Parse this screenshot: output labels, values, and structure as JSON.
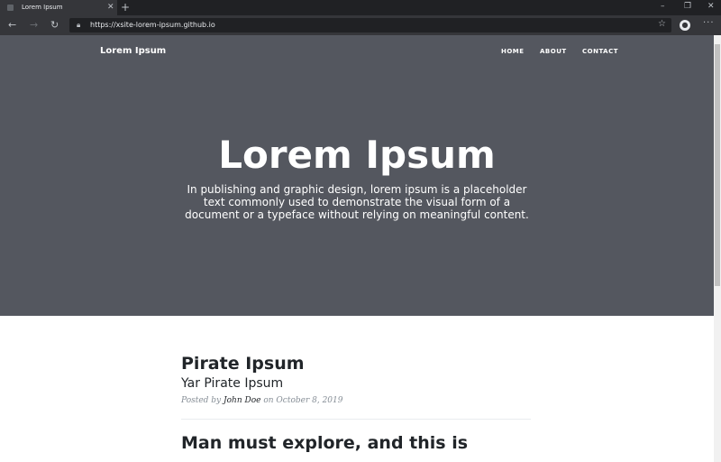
{
  "browser": {
    "tab_title": "Lorem Ipsum",
    "url": "https://xsite-lorem-ipsum.github.io"
  },
  "site": {
    "brand": "Lorem Ipsum",
    "nav": [
      "HOME",
      "ABOUT",
      "CONTACT"
    ]
  },
  "hero": {
    "title": "Lorem Ipsum",
    "subtitle": "In publishing and graphic design, lorem ipsum is a placeholder text commonly used to demonstrate the visual form of a document or a typeface without relying on meaningful content."
  },
  "posts": [
    {
      "title": "Pirate Ipsum",
      "subtitle": "Yar Pirate Ipsum",
      "meta_prefix": "Posted by",
      "author": "John Doe",
      "meta_on": "on October 8, 2019"
    },
    {
      "title": "Man must explore, and this is"
    }
  ],
  "colors": {
    "masthead": "#54575f",
    "text": "#212529",
    "meta": "#868e96"
  }
}
